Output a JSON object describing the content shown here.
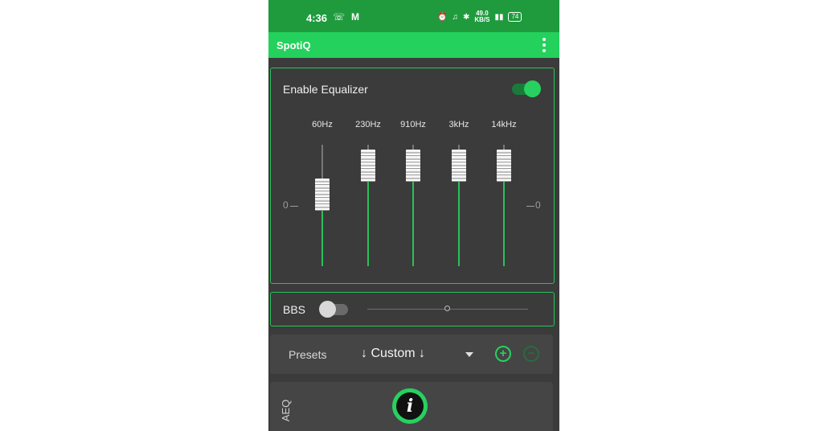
{
  "status_bar": {
    "time": "4:36",
    "left_icons": [
      "whatsapp-icon",
      "gmail-icon"
    ],
    "net_speed_value": "49.0",
    "net_speed_unit": "KB/S",
    "battery": "74"
  },
  "app_bar": {
    "title": "SpotiQ",
    "menu_icon": "more-vert-icon"
  },
  "equalizer": {
    "enable_label": "Enable Equalizer",
    "enabled": true,
    "zero_left": "0",
    "zero_right": "0",
    "bands": [
      {
        "label": "60Hz",
        "level": 0.62
      },
      {
        "label": "230Hz",
        "level": 0.95
      },
      {
        "label": "910Hz",
        "level": 0.95
      },
      {
        "label": "3kHz",
        "level": 0.95
      },
      {
        "label": "14kHz",
        "level": 0.95
      }
    ]
  },
  "bbs": {
    "label": "BBS",
    "enabled": false,
    "level": 0.5
  },
  "presets": {
    "label": "Presets",
    "value": "↓ Custom ↓",
    "add_icon": "+",
    "remove_icon": "−"
  },
  "aeq": {
    "label": "AEQ",
    "info_icon": "i"
  },
  "colors": {
    "status_bar": "#1f9b3e",
    "app_bar": "#23d15c",
    "accent": "#27d15f",
    "background": "#3b3b3b"
  }
}
